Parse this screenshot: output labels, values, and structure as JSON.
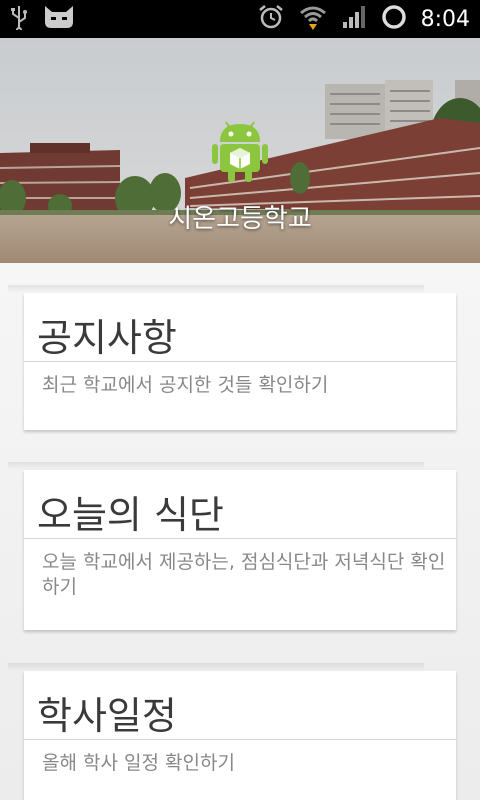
{
  "status_bar": {
    "time": "8:04",
    "icons": [
      "usb-icon",
      "cat-icon",
      "alarm-icon",
      "wifi-icon",
      "signal-icon",
      "battery-ring-icon"
    ]
  },
  "header": {
    "school_name": "시온고등학교",
    "logo": "android-app-icon"
  },
  "cards": [
    {
      "title": "공지사항",
      "description": "최근 학교에서 공지한 것들 확인하기"
    },
    {
      "title": "오늘의 식단",
      "description": "오늘 학교에서 제공하는, 점심식단과 저녁식단 확인하기"
    },
    {
      "title": "학사일정",
      "description": "올해 학사 일정 확인하기"
    }
  ],
  "colors": {
    "status_bar": "#000000",
    "card_bg": "#ffffff",
    "title_text": "#3a3a3a",
    "desc_text": "#888888",
    "android_green": "#8cc63e"
  }
}
